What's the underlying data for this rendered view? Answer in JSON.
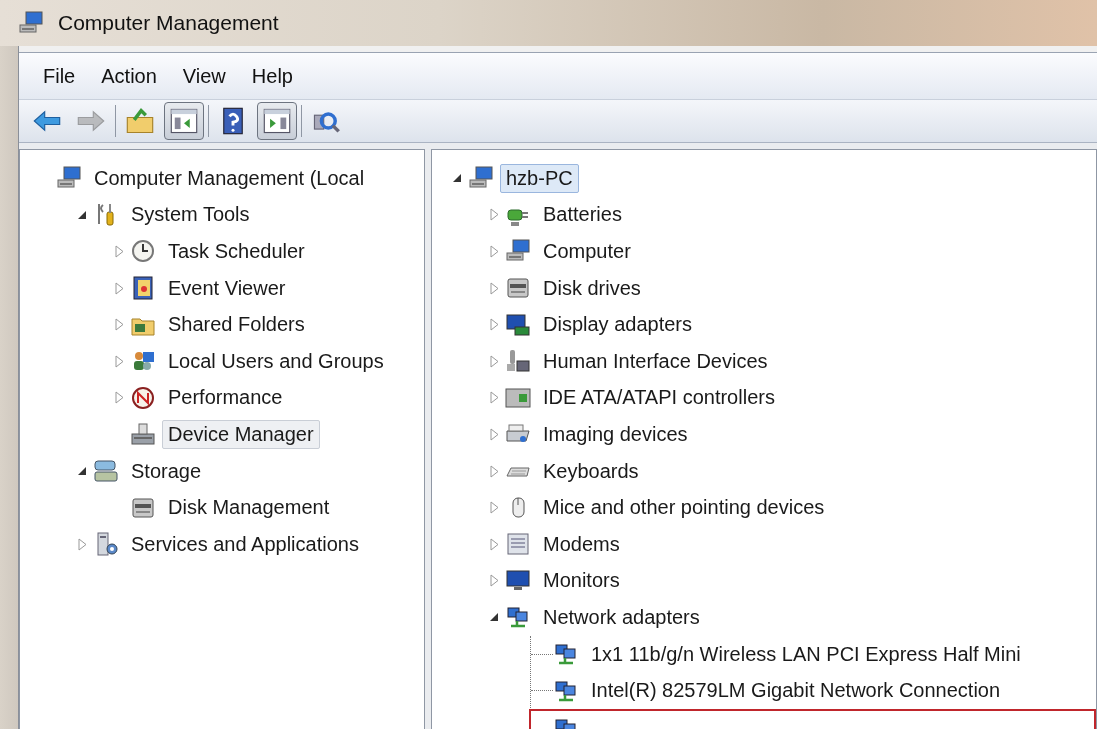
{
  "window": {
    "title": "Computer Management"
  },
  "menu": [
    {
      "label": "File"
    },
    {
      "label": "Action"
    },
    {
      "label": "View"
    },
    {
      "label": "Help"
    }
  ],
  "toolbar": [
    {
      "kind": "back",
      "disabled": false,
      "pressed": false
    },
    {
      "kind": "forward",
      "disabled": true,
      "pressed": false
    },
    {
      "kind": "separator"
    },
    {
      "kind": "up",
      "disabled": false,
      "pressed": false
    },
    {
      "kind": "console-tree",
      "disabled": false,
      "pressed": true
    },
    {
      "kind": "separator"
    },
    {
      "kind": "help",
      "disabled": false,
      "pressed": false
    },
    {
      "kind": "action-pane",
      "disabled": false,
      "pressed": true
    },
    {
      "kind": "separator"
    },
    {
      "kind": "scan",
      "disabled": false,
      "pressed": false
    }
  ],
  "left_tree": [
    {
      "label": "Computer Management (Local",
      "selected": false,
      "children": [
        {
          "label": "System Tools",
          "selected": false,
          "expanded": true,
          "children": [
            {
              "label": "Task Scheduler",
              "selected": false,
              "expanded": false
            },
            {
              "label": "Event Viewer",
              "selected": false,
              "expanded": false
            },
            {
              "label": "Shared Folders",
              "selected": false,
              "expanded": false
            },
            {
              "label": "Local Users and Groups",
              "selected": false,
              "expanded": false
            },
            {
              "label": "Performance",
              "selected": false,
              "expanded": false
            },
            {
              "label": "Device Manager",
              "selected": true
            }
          ]
        },
        {
          "label": "Storage",
          "selected": false,
          "expanded": true,
          "children": [
            {
              "label": "Disk Management",
              "selected": false
            }
          ]
        },
        {
          "label": "Services and Applications",
          "selected": false,
          "expanded": false
        }
      ]
    }
  ],
  "right_tree": [
    {
      "label": "hzb-PC",
      "selected": true,
      "expanded": true,
      "children": [
        {
          "label": "Batteries",
          "selected": false,
          "expanded": false
        },
        {
          "label": "Computer",
          "selected": false,
          "expanded": false
        },
        {
          "label": "Disk drives",
          "selected": false,
          "expanded": false
        },
        {
          "label": "Display adapters",
          "selected": false,
          "expanded": false
        },
        {
          "label": "Human Interface Devices",
          "selected": false,
          "expanded": false
        },
        {
          "label": "IDE ATA/ATAPI controllers",
          "selected": false,
          "expanded": false
        },
        {
          "label": "Imaging devices",
          "selected": false,
          "expanded": false
        },
        {
          "label": "Keyboards",
          "selected": false,
          "expanded": false
        },
        {
          "label": "Mice and other pointing devices",
          "selected": false,
          "expanded": false
        },
        {
          "label": "Modems",
          "selected": false,
          "expanded": false
        },
        {
          "label": "Monitors",
          "selected": false,
          "expanded": false
        },
        {
          "label": "Network adapters",
          "selected": false,
          "expanded": true,
          "children": [
            {
              "label": "1x1 11b/g/n Wireless LAN PCI Express Half Mini",
              "highlighted": false
            },
            {
              "label": "Intel(R) 82579LM Gigabit Network Connection",
              "highlighted": false
            },
            {
              "highlighted": true
            }
          ]
        }
      ]
    }
  ]
}
